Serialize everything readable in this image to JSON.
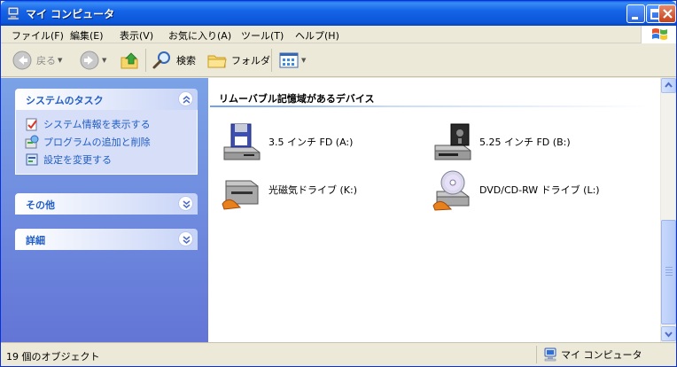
{
  "window": {
    "title": "マイ コンピュータ",
    "title_icon": "my-computer-icon"
  },
  "menubar": {
    "items": [
      "ファイル(F)",
      "編集(E)",
      "表示(V)",
      "お気に入り(A)",
      "ツール(T)",
      "ヘルプ(H)"
    ]
  },
  "toolbar": {
    "back_label": "戻る",
    "search_label": "検索",
    "folders_label": "フォルダ"
  },
  "tasks_panel": {
    "title": "システムのタスク",
    "items": [
      "システム情報を表示する",
      "プログラムの追加と削除",
      "設定を変更する"
    ]
  },
  "other_panel": {
    "title": "その他"
  },
  "details_panel": {
    "title": "詳細"
  },
  "content": {
    "group_title": "リムーバブル記憶域があるデバイス",
    "drives": [
      {
        "label": "3.5 インチ FD (A:)",
        "icon": "floppy-35-icon"
      },
      {
        "label": "5.25 インチ FD (B:)",
        "icon": "floppy-525-icon"
      },
      {
        "label": "光磁気ドライブ (K:)",
        "icon": "mo-drive-icon"
      },
      {
        "label": "DVD/CD-RW ドライブ (L:)",
        "icon": "dvd-drive-icon"
      }
    ]
  },
  "statusbar": {
    "object_count": "19 個のオブジェクト",
    "location": "マイ コンピュータ"
  },
  "colors": {
    "titlebar": "#0A5FE6",
    "task_link": "#215DC6",
    "left_pane_top": "#7BA2E7",
    "left_pane_bottom": "#6375D6"
  }
}
